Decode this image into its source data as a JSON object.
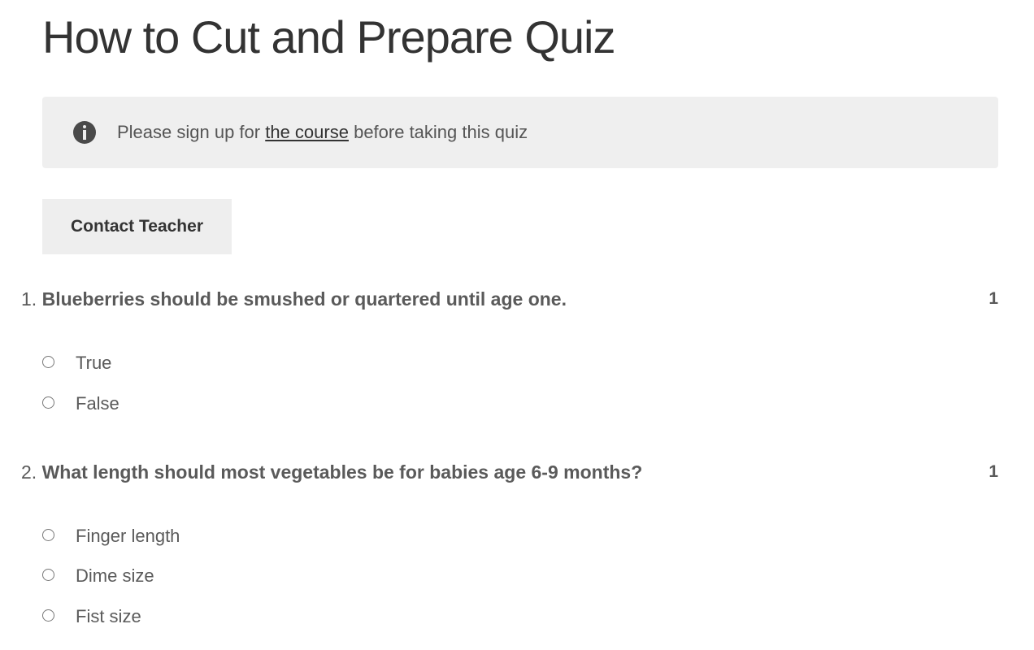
{
  "page": {
    "title": "How to Cut and Prepare Quiz"
  },
  "notice": {
    "icon": "info-icon",
    "text_before": "Please sign up for ",
    "link_text": "the course",
    "text_after": " before taking this quiz"
  },
  "contact_button": {
    "label": "Contact Teacher"
  },
  "questions": [
    {
      "number": "1.",
      "text": "Blueberries should be smushed or quartered until age one.",
      "points": "1",
      "answers": [
        {
          "label": "True"
        },
        {
          "label": "False"
        }
      ]
    },
    {
      "number": "2.",
      "text": "What length should most vegetables be for babies age 6-9 months?",
      "points": "1",
      "answers": [
        {
          "label": "Finger length"
        },
        {
          "label": "Dime size"
        },
        {
          "label": "Fist size"
        }
      ]
    }
  ]
}
